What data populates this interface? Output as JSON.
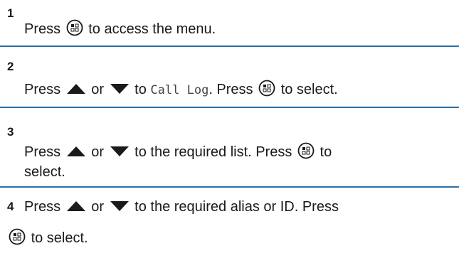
{
  "steps": [
    {
      "number": "1",
      "pre": "Press",
      "post": "to access the menu."
    },
    {
      "number": "2",
      "press": "Press",
      "or": "or",
      "to": "to",
      "mono_target": "Call Log",
      "after_mono": ". Press",
      "post": "to select."
    },
    {
      "number": "3",
      "press": "Press",
      "or": "or",
      "mid": "to the required list. Press",
      "post": "to",
      "line2": "select."
    },
    {
      "number": "4",
      "press": "Press",
      "or": "or",
      "mid": "to the required alias or ID. Press",
      "line2": "to select."
    }
  ],
  "colors": {
    "divider": "#2b6ea6",
    "text": "#1a1a1a"
  },
  "icons": [
    "menu-ok-button-icon",
    "up-arrow-icon",
    "down-arrow-icon"
  ]
}
